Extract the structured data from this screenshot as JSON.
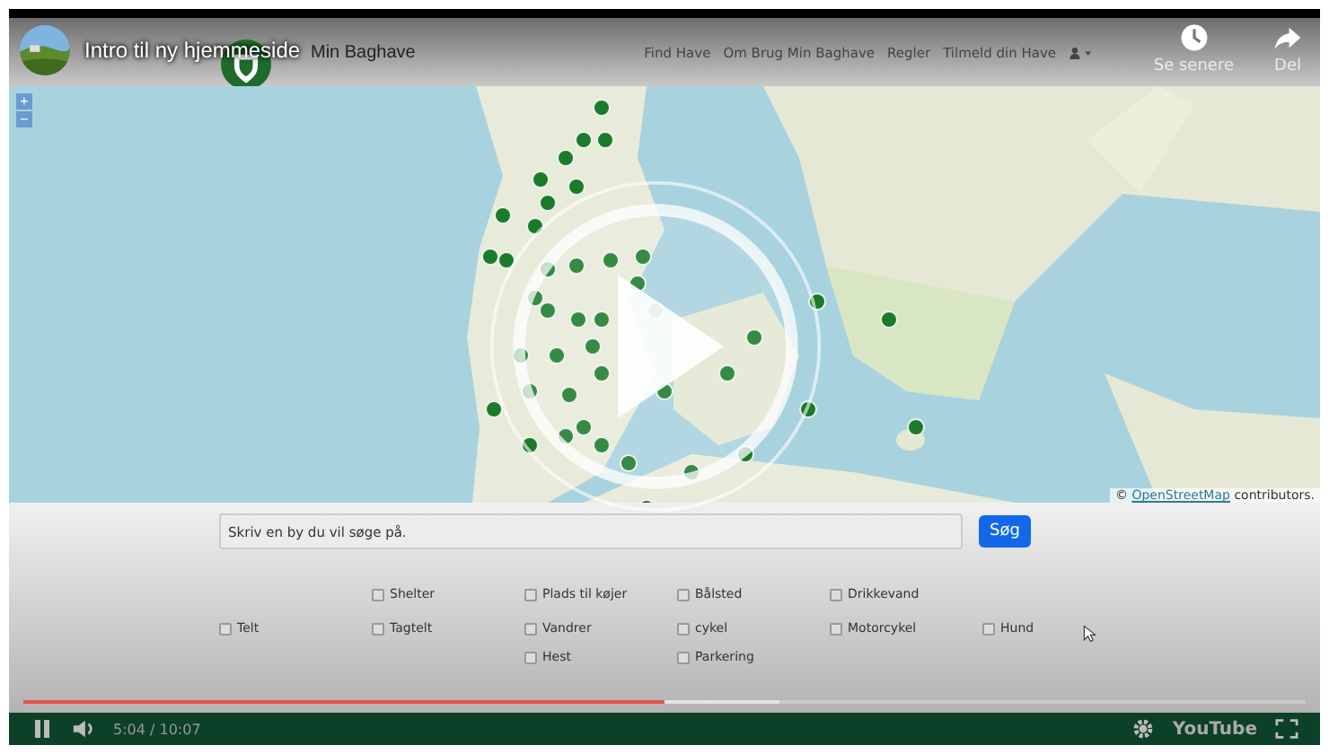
{
  "video": {
    "title": "Intro til ny hjemmeside",
    "actions": [
      {
        "kind": "clock",
        "label": "Se senere"
      },
      {
        "kind": "share",
        "label": "Del"
      }
    ]
  },
  "site": {
    "brand": "Min Baghave",
    "nav": [
      "Find Have",
      "Om Brug Min Baghave",
      "Regler",
      "Tilmeld din Have"
    ]
  },
  "map": {
    "zoom": [
      "+",
      "−"
    ],
    "attribution_prefix": "©",
    "attribution_link": "OpenStreetMap",
    "attribution_suffix": "contributors."
  },
  "search": {
    "placeholder": "Skriv en by du vil søge på.",
    "button": "Søg"
  },
  "filters": [
    [
      {
        "label": "Shelter",
        "checked": false
      },
      {
        "label": "Plads til køjer",
        "checked": false
      },
      {
        "label": "Bålsted",
        "checked": false
      },
      {
        "label": "Drikkevand",
        "checked": false
      }
    ],
    [
      {
        "label": "Telt",
        "checked": false
      },
      {
        "label": "Tagtelt",
        "checked": false
      },
      {
        "label": "Vandrer",
        "checked": false
      },
      {
        "label": "cykel",
        "checked": false
      },
      {
        "label": "Motorcykel",
        "checked": false
      },
      {
        "label": "Hund",
        "checked": false
      }
    ],
    [
      {
        "label": "Hest",
        "checked": false
      },
      {
        "label": "Parkering",
        "checked": false
      }
    ]
  ],
  "player": {
    "playing": true,
    "progress": {
      "level": 0.5
    },
    "time": "5:04 / 10:07",
    "logo": "YouTube"
  }
}
